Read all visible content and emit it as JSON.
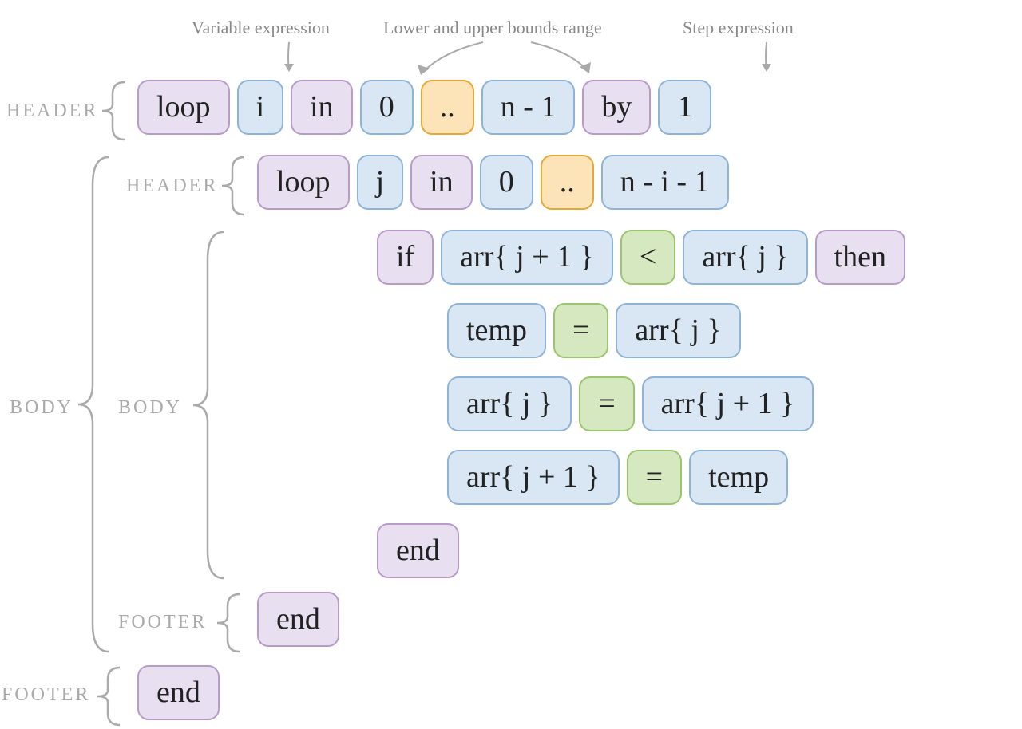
{
  "annotations": {
    "var_expr": "Variable expression",
    "bounds": "Lower and upper bounds range",
    "step": "Step expression"
  },
  "labels": {
    "header1": "HEADER",
    "body1": "BODY",
    "header2": "HEADER",
    "body2": "BODY",
    "footer2": "FOOTER",
    "footer1": "FOOTER"
  },
  "rows": {
    "r1": {
      "loop": "loop",
      "i": "i",
      "in": "in",
      "zero": "0",
      "dots": "..",
      "upper": "n - 1",
      "by": "by",
      "one": "1"
    },
    "r2": {
      "loop": "loop",
      "j": "j",
      "in": "in",
      "zero": "0",
      "dots": "..",
      "upper": "n - i - 1"
    },
    "r3": {
      "if": "if",
      "a": "arr{ j + 1 }",
      "op": "<",
      "b": "arr{ j }",
      "then": "then"
    },
    "r4": {
      "a": "temp",
      "op": "=",
      "b": "arr{ j }"
    },
    "r5": {
      "a": "arr{ j }",
      "op": "=",
      "b": "arr{ j + 1 }"
    },
    "r6": {
      "a": "arr{ j + 1 }",
      "op": "=",
      "b": "temp"
    },
    "r7": {
      "end": "end"
    },
    "r8": {
      "end": "end"
    },
    "r9": {
      "end": "end"
    }
  }
}
